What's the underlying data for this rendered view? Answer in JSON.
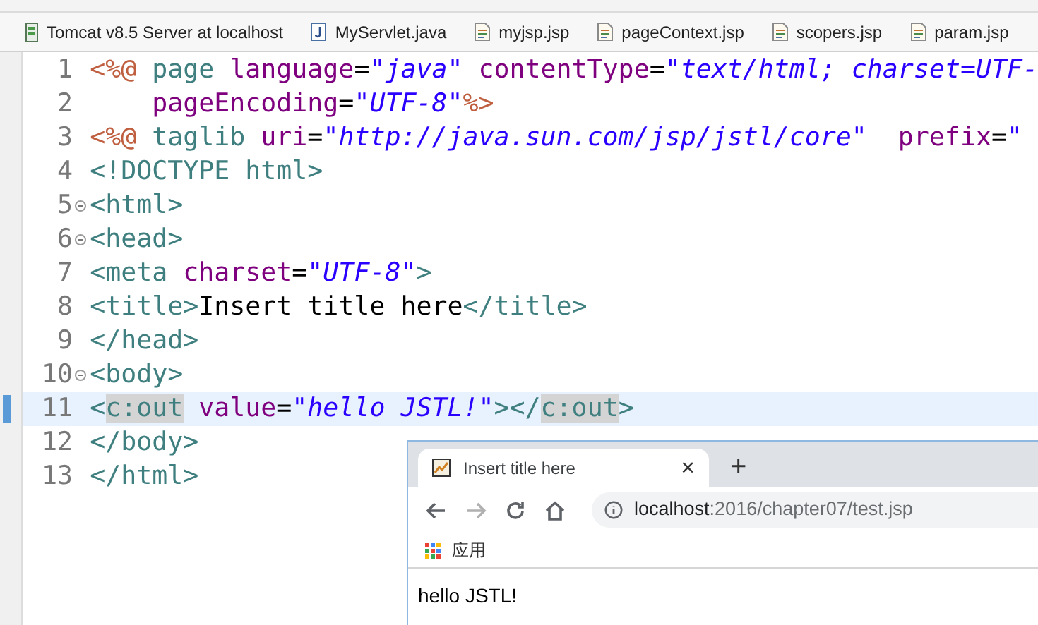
{
  "editor_tabs": [
    {
      "label": "Tomcat v8.5 Server at localhost",
      "kind": "server"
    },
    {
      "label": "MyServlet.java",
      "kind": "java"
    },
    {
      "label": "myjsp.jsp",
      "kind": "jsp"
    },
    {
      "label": "pageContext.jsp",
      "kind": "jsp"
    },
    {
      "label": "scopers.jsp",
      "kind": "jsp"
    },
    {
      "label": "param.jsp",
      "kind": "jsp"
    }
  ],
  "code_lines": [
    {
      "number": "1",
      "foldable": false,
      "current": false,
      "tokens": [
        {
          "kind": "directive",
          "text": "<%@"
        },
        {
          "kind": "tag",
          "text": " page"
        },
        {
          "kind": "attr",
          "text": " language"
        },
        {
          "kind": "plain",
          "text": "="
        },
        {
          "kind": "string",
          "text": "\"java\""
        },
        {
          "kind": "attr",
          "text": " contentType"
        },
        {
          "kind": "plain",
          "text": "="
        },
        {
          "kind": "string",
          "text": "\"text/html; charset=UTF-"
        }
      ]
    },
    {
      "number": "2",
      "foldable": false,
      "current": false,
      "tokens": [
        {
          "kind": "attr",
          "text": "    pageEncoding"
        },
        {
          "kind": "plain",
          "text": "="
        },
        {
          "kind": "string",
          "text": "\"UTF-8\""
        },
        {
          "kind": "directive",
          "text": "%>"
        }
      ]
    },
    {
      "number": "3",
      "foldable": false,
      "current": false,
      "tokens": [
        {
          "kind": "directive",
          "text": "<%@"
        },
        {
          "kind": "tag",
          "text": " taglib"
        },
        {
          "kind": "attr",
          "text": " uri"
        },
        {
          "kind": "plain",
          "text": "="
        },
        {
          "kind": "string",
          "text": "\"http://java.sun.com/jsp/jstl/core\""
        },
        {
          "kind": "attr",
          "text": "  prefix"
        },
        {
          "kind": "plain",
          "text": "="
        },
        {
          "kind": "string",
          "text": "\""
        }
      ]
    },
    {
      "number": "4",
      "foldable": false,
      "current": false,
      "tokens": [
        {
          "kind": "tag",
          "text": "<!DOCTYPE html>"
        }
      ]
    },
    {
      "number": "5",
      "foldable": true,
      "current": false,
      "tokens": [
        {
          "kind": "tag",
          "text": "<html>"
        }
      ]
    },
    {
      "number": "6",
      "foldable": true,
      "current": false,
      "tokens": [
        {
          "kind": "tag",
          "text": "<head>"
        }
      ]
    },
    {
      "number": "7",
      "foldable": false,
      "current": false,
      "tokens": [
        {
          "kind": "tag",
          "text": "<meta"
        },
        {
          "kind": "attr",
          "text": " charset"
        },
        {
          "kind": "plain",
          "text": "="
        },
        {
          "kind": "string",
          "text": "\"UTF-8\""
        },
        {
          "kind": "tag",
          "text": ">"
        }
      ]
    },
    {
      "number": "8",
      "foldable": false,
      "current": false,
      "tokens": [
        {
          "kind": "tag",
          "text": "<title>"
        },
        {
          "kind": "text",
          "text": "Insert title here"
        },
        {
          "kind": "tag",
          "text": "</title>"
        }
      ]
    },
    {
      "number": "9",
      "foldable": false,
      "current": false,
      "tokens": [
        {
          "kind": "tag",
          "text": "</head>"
        }
      ]
    },
    {
      "number": "10",
      "foldable": true,
      "current": false,
      "tokens": [
        {
          "kind": "tag",
          "text": "<body>"
        }
      ]
    },
    {
      "number": "11",
      "foldable": false,
      "current": true,
      "tokens": [
        {
          "kind": "tag",
          "text": "<"
        },
        {
          "kind": "match",
          "text": "c:out"
        },
        {
          "kind": "attr",
          "text": " value"
        },
        {
          "kind": "plain",
          "text": "="
        },
        {
          "kind": "string",
          "text": "\"hello JSTL!\""
        },
        {
          "kind": "tag",
          "text": "></"
        },
        {
          "kind": "match",
          "text": "c:out"
        },
        {
          "kind": "tag",
          "text": ">"
        }
      ]
    },
    {
      "number": "12",
      "foldable": false,
      "current": false,
      "tokens": [
        {
          "kind": "tag",
          "text": "</body>"
        }
      ]
    },
    {
      "number": "13",
      "foldable": false,
      "current": false,
      "tokens": [
        {
          "kind": "tag",
          "text": "</html>"
        }
      ]
    }
  ],
  "browser": {
    "tab": {
      "title": "Insert title here",
      "close": "×"
    },
    "new_tab": "+",
    "nav": [
      {
        "kind": "back",
        "disabled": false
      },
      {
        "kind": "forward",
        "disabled": true
      },
      {
        "kind": "reload",
        "disabled": false
      },
      {
        "kind": "home",
        "disabled": false
      }
    ],
    "url": {
      "host": "localhost",
      "path": ":2016/chapter07/test.jsp"
    },
    "bookmarks": [
      {
        "label": "应用"
      }
    ],
    "content": "hello JSTL!"
  }
}
